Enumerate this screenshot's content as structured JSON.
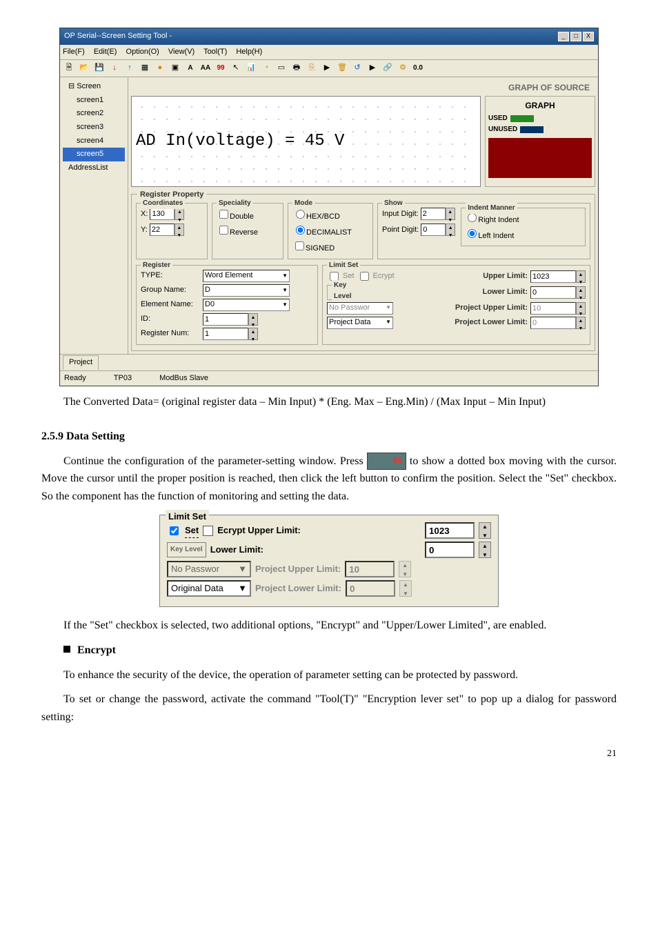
{
  "window": {
    "title": "OP Serial--Screen Setting Tool -",
    "close": "X",
    "min": "_",
    "max": "□"
  },
  "menu": {
    "file": "File(F)",
    "edit": "Edit(E)",
    "option": "Option(O)",
    "view": "View(V)",
    "tool": "Tool(T)",
    "help": "Help(H)"
  },
  "toolbar": {
    "a": "A",
    "aa": "AA",
    "n99": "99",
    "zero": "0.0"
  },
  "tree": {
    "root": "Screen",
    "items": [
      "screen1",
      "screen2",
      "screen3",
      "screen4",
      "screen5"
    ],
    "addr": "AddressList"
  },
  "graph": {
    "source": "GRAPH OF SOURCE",
    "text": "AD  In(voltage)  = 45 V",
    "title": "GRAPH",
    "used": "USED",
    "unused": "UNUSED"
  },
  "regprop": {
    "title": "Register Property",
    "coord": {
      "title": "Coordinates",
      "xl": "X:",
      "xv": "130",
      "yl": "Y:",
      "yv": "22"
    },
    "spec": {
      "title": "Speciality",
      "double": "Double",
      "reverse": "Reverse"
    },
    "mode": {
      "title": "Mode",
      "hex": "HEX/BCD",
      "dec": "DECIMALIST",
      "signed": "SIGNED"
    },
    "show": {
      "title": "Show",
      "idl": "Input Digit:",
      "idv": "2",
      "pdl": "Point Digit:",
      "pdv": "0",
      "im": "Indent Manner",
      "ri": "Right Indent",
      "li": "Left Indent"
    },
    "register": {
      "title": "Register",
      "typel": "TYPE:",
      "typev": "Word Element",
      "gnl": "Group Name:",
      "gnv": "D",
      "enl": "Element Name:",
      "env": "D0",
      "idl": "ID:",
      "idv": "1",
      "rnl": "Register Num:",
      "rnv": "1"
    },
    "limit": {
      "title": "Limit Set",
      "set": "Set",
      "ecrypt": "Ecrypt",
      "ull": "Upper Limit:",
      "ulv": "1023",
      "key": "Key Level",
      "lll": "Lower Limit:",
      "llv": "0",
      "nopass": "No Passwor",
      "pul": "Project Upper Limit:",
      "puv": "10",
      "pdsel": "Project Data",
      "pll": "Project Lower Limit:",
      "plv": "0"
    }
  },
  "tab": "Project",
  "status": {
    "ready": "Ready",
    "tp": "TP03",
    "ms": "ModBus Slave"
  },
  "para1": "The Converted Data= (original register data – Min Input) * (Eng. Max – Eng.Min) / (Max Input – Min Input)",
  "h259": "2.5.9 Data Setting",
  "para2a": "Continue the configuration of the parameter-setting window. Press ",
  "icon99": "99",
  "para2b": " to show a dotted box moving with the cursor. Move the cursor until the proper position is reached, then click the left button to confirm the position. Select the \"Set\" checkbox. So the component has the function of monitoring and setting the data.",
  "limitPanel": {
    "title": "Limit Set",
    "set": "Set",
    "ecrypt": "Ecrypt Upper Limit:",
    "ulv": "1023",
    "key": "Key Level",
    "lll": "Lower Limit:",
    "llv": "0",
    "nopass": "No Passwor",
    "pul": "Project Upper Limit:",
    "puv": "10",
    "od": "Original Data",
    "pll": "Project Lower Limit:",
    "plv": "0"
  },
  "para3": "If the \"Set\" checkbox is selected, two additional options, \"Encrypt\" and \"Upper/Lower Limited\", are enabled.",
  "encrypt": "Encrypt",
  "para4": "To enhance the security of the device, the operation of parameter setting can be protected by password.",
  "para5": "To set or change the password, activate the command \"Tool(T)\"    \"Encryption lever set\" to pop up a dialog for password setting:",
  "page": "21"
}
